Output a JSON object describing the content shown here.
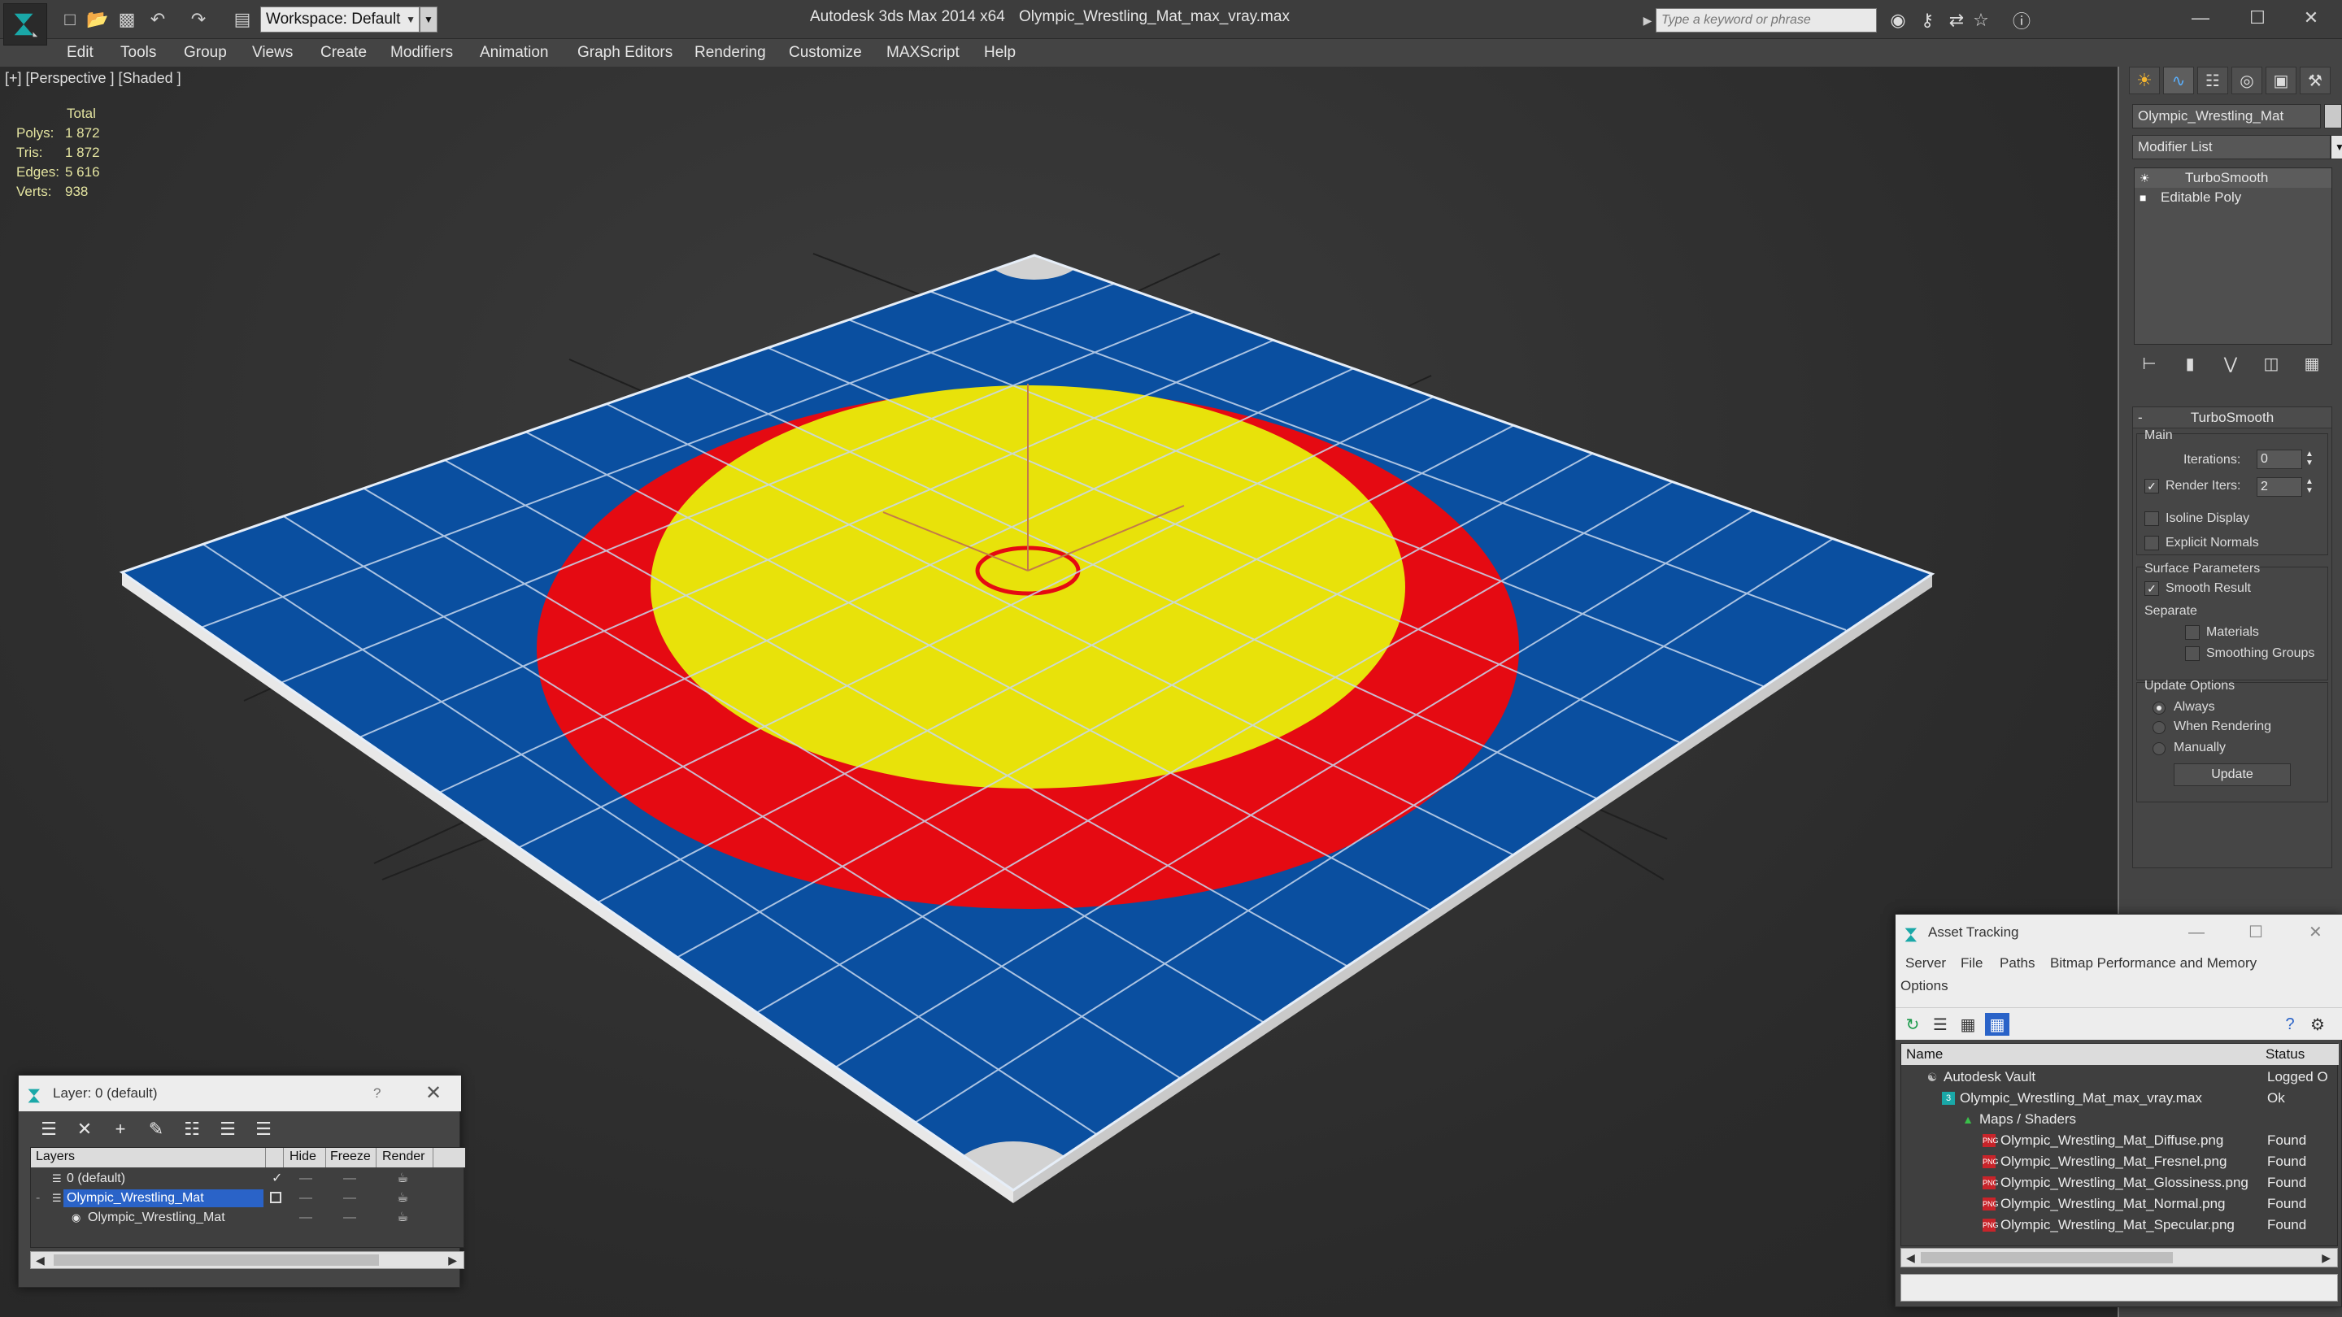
{
  "titlebar": {
    "workspace": "Workspace: Default",
    "app_title": "Autodesk 3ds Max  2014 x64",
    "file_title": "Olympic_Wrestling_Mat_max_vray.max",
    "search_placeholder": "Type a keyword or phrase",
    "quick_access_icons": [
      "new-file-icon",
      "open-file-icon",
      "save-icon",
      "undo-icon",
      "redo-icon",
      "project-folder-icon"
    ],
    "toolbar_icons": [
      "binoculars-icon",
      "key-icon",
      "exchange-icon",
      "star-icon",
      "help-icon"
    ],
    "window_buttons": [
      "minimize-icon",
      "maximize-icon",
      "close-icon"
    ]
  },
  "menu": {
    "items": [
      "Edit",
      "Tools",
      "Group",
      "Views",
      "Create",
      "Modifiers",
      "Animation",
      "Graph Editors",
      "Rendering",
      "Customize",
      "MAXScript",
      "Help"
    ]
  },
  "viewport": {
    "label": "[+] [Perspective ] [Shaded ]",
    "stats": {
      "header": "Total",
      "rows": [
        {
          "key": "Polys:",
          "value": "1 872"
        },
        {
          "key": "Tris:",
          "value": "1 872"
        },
        {
          "key": "Edges:",
          "value": "5 616"
        },
        {
          "key": "Verts:",
          "value": "938"
        }
      ]
    },
    "colors": {
      "mat_blue": "#0a4fa0",
      "mat_red": "#e50a12",
      "mat_yellow": "#e8e20a",
      "corner_white": "#d2d2d2"
    }
  },
  "command_panel": {
    "tabs": [
      "create-icon",
      "modify-icon",
      "hierarchy-icon",
      "motion-icon",
      "display-icon",
      "utilities-icon"
    ],
    "object_name": "Olympic_Wrestling_Mat",
    "modifier_list": "Modifier List",
    "stack": [
      "TurboSmooth",
      "Editable Poly"
    ],
    "turbosmooth": {
      "title": "TurboSmooth",
      "main": "Main",
      "iterations_label": "Iterations:",
      "iterations_value": "0",
      "render_iters_label": "Render Iters:",
      "render_iters_value": "2",
      "isoline": "Isoline Display",
      "explicit": "Explicit Normals",
      "surface": "Surface Parameters",
      "smooth_result": "Smooth Result",
      "separate": "Separate",
      "materials": "Materials",
      "smoothing_groups": "Smoothing Groups",
      "update_options": "Update Options",
      "always": "Always",
      "when_rendering": "When Rendering",
      "manually": "Manually",
      "update_button": "Update"
    }
  },
  "layer_window": {
    "title": "Layer: 0 (default)",
    "help": "?",
    "columns": [
      "Layers",
      "Hide",
      "Freeze",
      "Render"
    ],
    "rows": [
      {
        "name": "0 (default)",
        "selected": false
      },
      {
        "name": "Olympic_Wrestling_Mat",
        "selected": true
      },
      {
        "name": "Olympic_Wrestling_Mat",
        "selected": false
      }
    ],
    "hide_dash": "—",
    "freeze_dash": "—"
  },
  "asset_window": {
    "title": "Asset Tracking",
    "menu": [
      "Server",
      "File",
      "Paths",
      "Bitmap Performance and Memory",
      "Options"
    ],
    "columns": [
      "Name",
      "Status"
    ],
    "rows": [
      {
        "name": "Autodesk Vault",
        "status": "Logged O"
      },
      {
        "name": "Olympic_Wrestling_Mat_max_vray.max",
        "status": "Ok"
      },
      {
        "name": "Maps / Shaders",
        "status": ""
      },
      {
        "name": "Olympic_Wrestling_Mat_Diffuse.png",
        "status": "Found"
      },
      {
        "name": "Olympic_Wrestling_Mat_Fresnel.png",
        "status": "Found"
      },
      {
        "name": "Olympic_Wrestling_Mat_Glossiness.png",
        "status": "Found"
      },
      {
        "name": "Olympic_Wrestling_Mat_Normal.png",
        "status": "Found"
      },
      {
        "name": "Olympic_Wrestling_Mat_Specular.png",
        "status": "Found"
      }
    ],
    "png_badge": "PNG"
  }
}
